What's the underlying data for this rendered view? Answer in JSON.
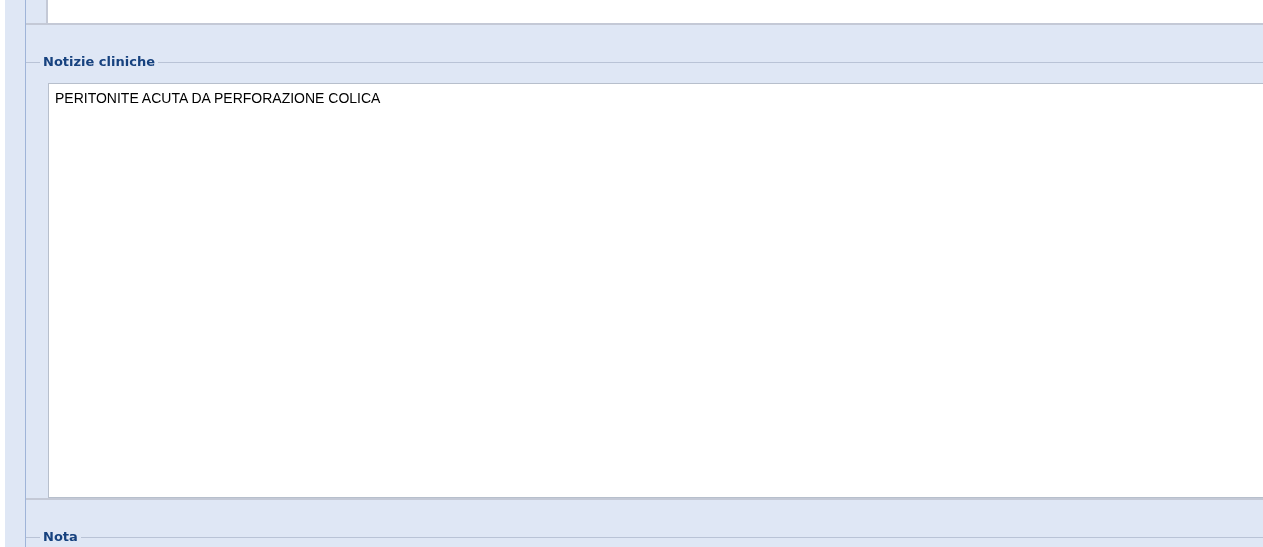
{
  "sections": [
    {
      "legend": "Notizie cliniche",
      "value": "PERITONITE ACUTA DA PERFORAZIONE COLICA"
    },
    {
      "legend": "Nota"
    }
  ]
}
